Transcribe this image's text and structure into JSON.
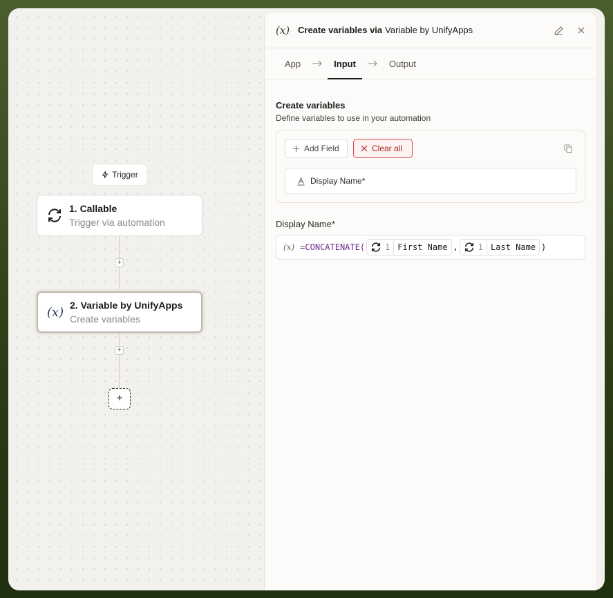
{
  "canvas": {
    "trigger_chip": "Trigger",
    "nodes": [
      {
        "title": "1. Callable",
        "subtitle": "Trigger via automation",
        "icon": "refresh-icon"
      },
      {
        "title": "2. Variable by UnifyApps",
        "subtitle": "Create variables",
        "icon": "variable-icon"
      }
    ],
    "add_symbol": "+"
  },
  "panel": {
    "header": {
      "icon": "(x)",
      "title": "Create variables via",
      "app": "Variable by UnifyApps"
    },
    "tabs": [
      {
        "label": "App",
        "active": false
      },
      {
        "label": "Input",
        "active": true
      },
      {
        "label": "Output",
        "active": false
      }
    ],
    "section": {
      "title": "Create variables",
      "subtitle": "Define variables to use in your automation"
    },
    "buttons": {
      "add_field": "Add Field",
      "clear_all": "Clear all"
    },
    "fields": [
      {
        "label": "Display Name*"
      }
    ],
    "formula": {
      "label": "Display Name*",
      "fx": "(x)",
      "function": "=CONCATENATE(",
      "separator": ",",
      "close": ")",
      "tokens": [
        {
          "step": "1",
          "name": "First Name"
        },
        {
          "step": "1",
          "name": "Last Name"
        }
      ]
    }
  },
  "colors": {
    "frame_bg": "#3a4a22",
    "canvas_bg": "#f2f1ee",
    "panel_bg": "#fcfbf9",
    "danger": "#d24b4b",
    "function_color": "#6d2a8f"
  }
}
